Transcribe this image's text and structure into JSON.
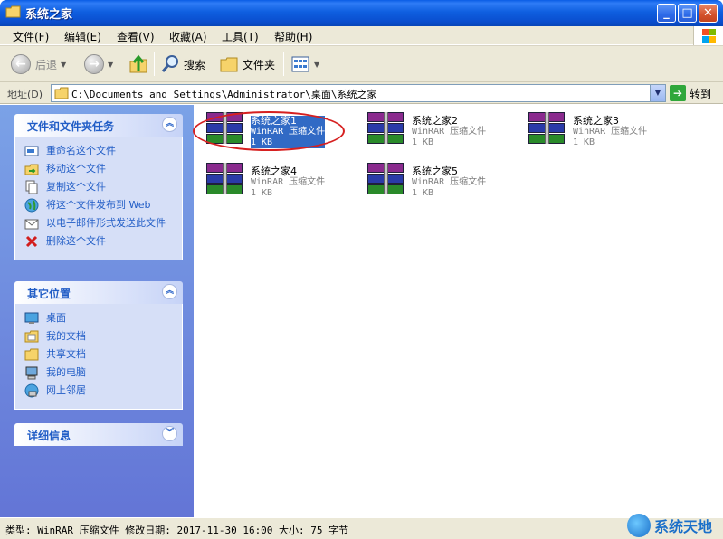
{
  "window": {
    "title": "系统之家"
  },
  "menu": [
    "文件(F)",
    "编辑(E)",
    "查看(V)",
    "收藏(A)",
    "工具(T)",
    "帮助(H)"
  ],
  "toolbar": {
    "back": "后退",
    "search": "搜索",
    "folders": "文件夹"
  },
  "address": {
    "label": "地址(D)",
    "path": "C:\\Documents and Settings\\Administrator\\桌面\\系统之家",
    "go": "转到"
  },
  "tasks_panel": {
    "title": "文件和文件夹任务",
    "items": [
      "重命名这个文件",
      "移动这个文件",
      "复制这个文件",
      "将这个文件发布到 Web",
      "以电子邮件形式发送此文件",
      "删除这个文件"
    ]
  },
  "places_panel": {
    "title": "其它位置",
    "items": [
      "桌面",
      "我的文档",
      "共享文档",
      "我的电脑",
      "网上邻居"
    ]
  },
  "details_panel": {
    "title": "详细信息"
  },
  "files": [
    {
      "name": "系统之家1",
      "type": "WinRAR 压缩文件",
      "size": "1 KB",
      "selected": true
    },
    {
      "name": "系统之家2",
      "type": "WinRAR 压缩文件",
      "size": "1 KB"
    },
    {
      "name": "系统之家3",
      "type": "WinRAR 压缩文件",
      "size": "1 KB"
    },
    {
      "name": "系统之家4",
      "type": "WinRAR 压缩文件",
      "size": "1 KB"
    },
    {
      "name": "系统之家5",
      "type": "WinRAR 压缩文件",
      "size": "1 KB"
    }
  ],
  "status": "类型: WinRAR 压缩文件 修改日期: 2017-11-30 16:00 大小: 75 字节",
  "watermark": "系统天地",
  "colors": {
    "title_bar": "#0a4fd0",
    "task_link": "#215dc6",
    "selection": "#316ac5",
    "highlight_ring": "#d62020"
  }
}
